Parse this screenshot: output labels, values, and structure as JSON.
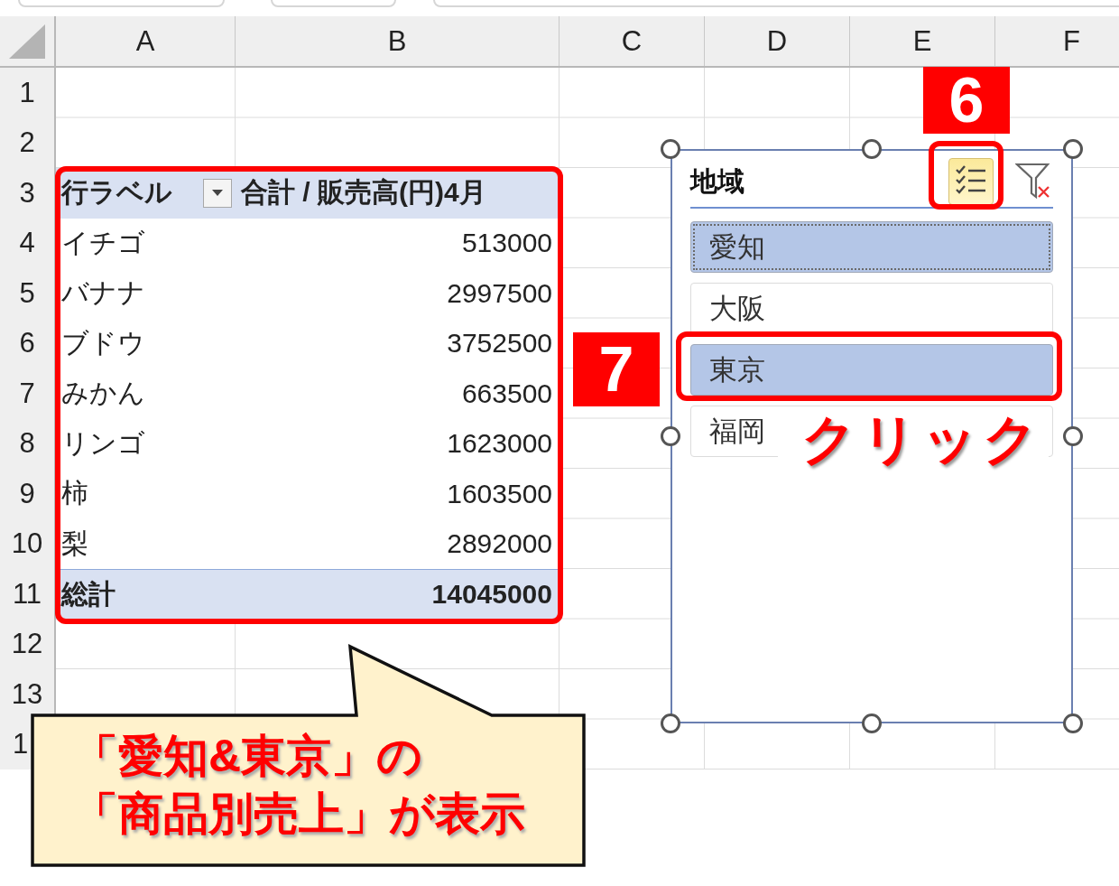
{
  "column_headers": [
    "A",
    "B",
    "C",
    "D",
    "E",
    "F"
  ],
  "row_numbers": [
    "1",
    "2",
    "3",
    "4",
    "5",
    "6",
    "7",
    "8",
    "9",
    "10",
    "11",
    "12",
    "13",
    "1"
  ],
  "pivot_table": {
    "row_label": "行ラベル",
    "value_label": "合計 / 販売高(円)4月",
    "rows": [
      {
        "label": "イチゴ",
        "value": "513000"
      },
      {
        "label": "バナナ",
        "value": "2997500"
      },
      {
        "label": "ブドウ",
        "value": "3752500"
      },
      {
        "label": "みかん",
        "value": "663500"
      },
      {
        "label": "リンゴ",
        "value": "1623000"
      },
      {
        "label": "柿",
        "value": "1603500"
      },
      {
        "label": "梨",
        "value": "2892000"
      }
    ],
    "total": {
      "label": "総計",
      "value": "14045000"
    }
  },
  "slicer": {
    "title": "地域",
    "multi_select": true,
    "items": [
      {
        "label": "愛知",
        "selected": true
      },
      {
        "label": "大阪",
        "selected": false
      },
      {
        "label": "東京",
        "selected": true
      },
      {
        "label": "福岡",
        "selected": false
      }
    ]
  },
  "annotations": {
    "step_badges": [
      "6",
      "7"
    ],
    "click_label": "クリック",
    "callout_lines": [
      "「愛知&東京」の",
      "「商品別売上」が表示"
    ]
  }
}
